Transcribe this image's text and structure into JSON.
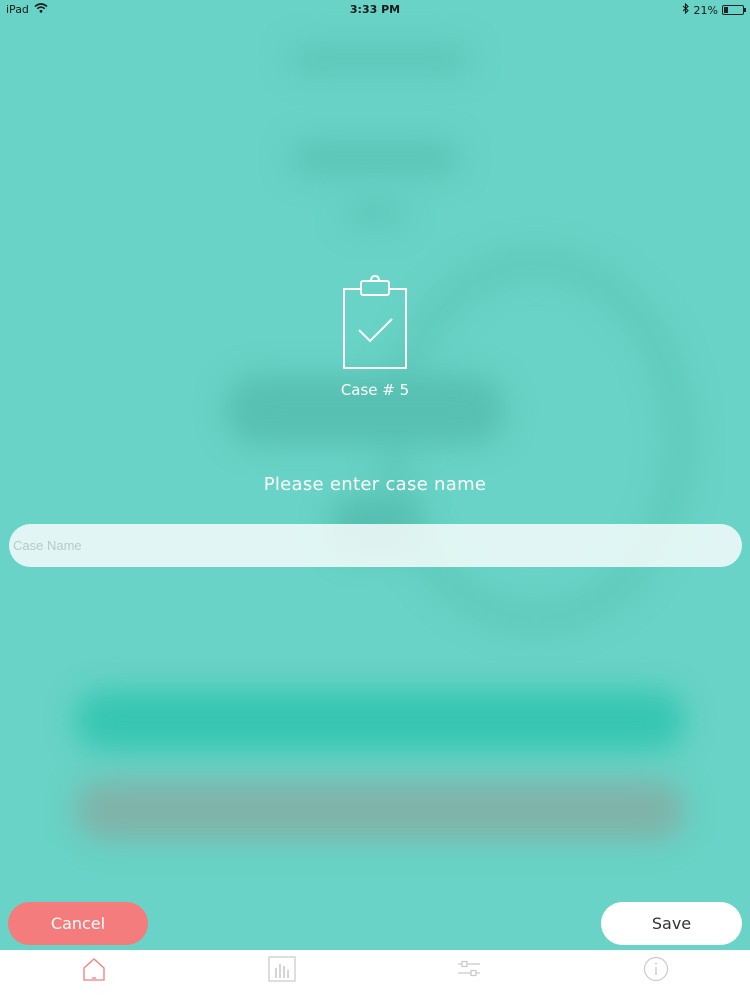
{
  "status_bar": {
    "device": "iPad",
    "time": "3:33 PM",
    "battery": "21%"
  },
  "dialog": {
    "case_number": "Case # 5",
    "prompt": "Please enter case name",
    "input_placeholder": "Case Name",
    "input_value": ""
  },
  "actions": {
    "cancel_label": "Cancel",
    "save_label": "Save"
  },
  "tab_bar": {
    "tabs": [
      {
        "icon": "home-icon",
        "active": true
      },
      {
        "icon": "bar-chart-icon",
        "active": false
      },
      {
        "icon": "sliders-icon",
        "active": false
      },
      {
        "icon": "info-icon",
        "active": false
      }
    ]
  },
  "colors": {
    "background": "#68d3c6",
    "cancel": "#f57c7c",
    "active_tab": "#f57c7c",
    "inactive_tab": "#c9c9c9"
  }
}
